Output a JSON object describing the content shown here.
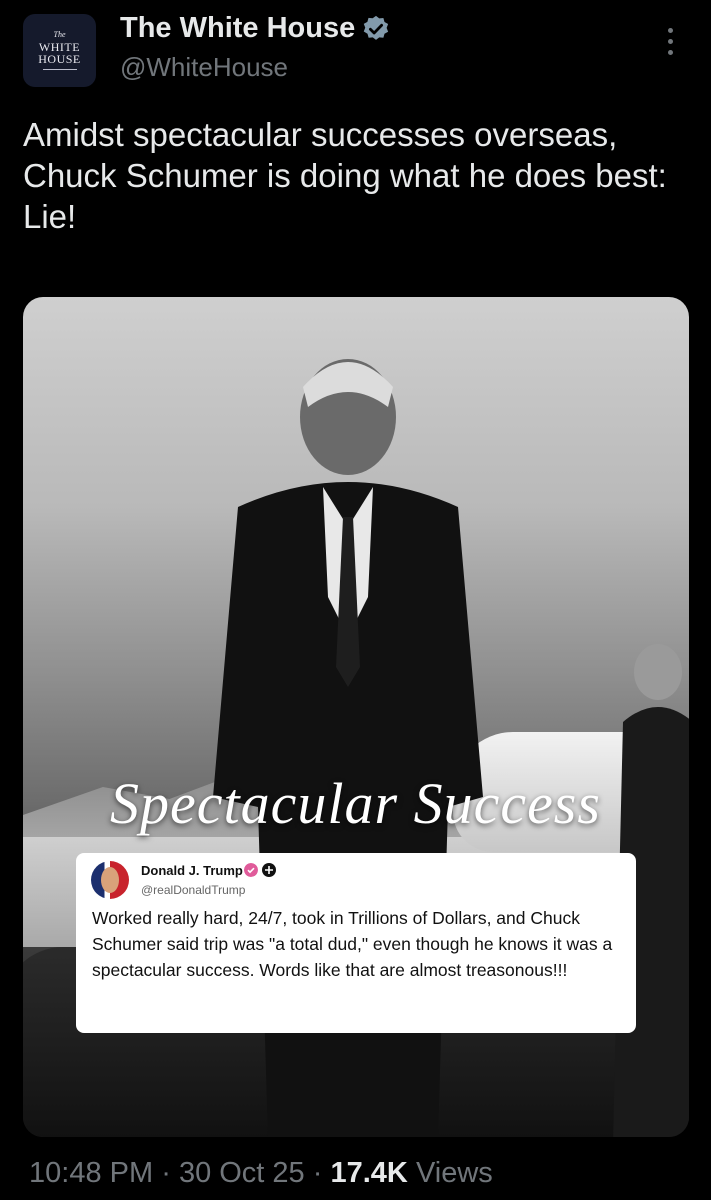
{
  "account": {
    "avatar_the": "The",
    "avatar_line1": "WHITE",
    "avatar_line2": "HOUSE",
    "name": "The White House",
    "handle": "@WhiteHouse"
  },
  "tweet": {
    "text": "Amidst spectacular successes overseas, Chuck Schumer is doing what he does best: Lie!"
  },
  "media": {
    "overlay_title": "Spectacular Success",
    "quoted_post": {
      "name": "Donald J. Trump",
      "handle": "@realDonaldTrump",
      "text": "Worked really hard, 24/7, took in Trillions of Dollars, and Chuck Schumer said trip was \"a total dud,\" even though he knows it was a spectacular success. Words like that are almost treasonous!!!"
    }
  },
  "meta": {
    "time": "10:48 PM",
    "separator": "·",
    "date": "30 Oct 25",
    "views_count": "17.4K",
    "views_label": "Views"
  },
  "colors": {
    "background": "#000000",
    "text_primary": "#e7e9ea",
    "text_secondary": "#71767b",
    "verified_badge": "#829aab"
  },
  "icons": {
    "verified": "verified-badge-icon",
    "more": "more-options-icon"
  }
}
